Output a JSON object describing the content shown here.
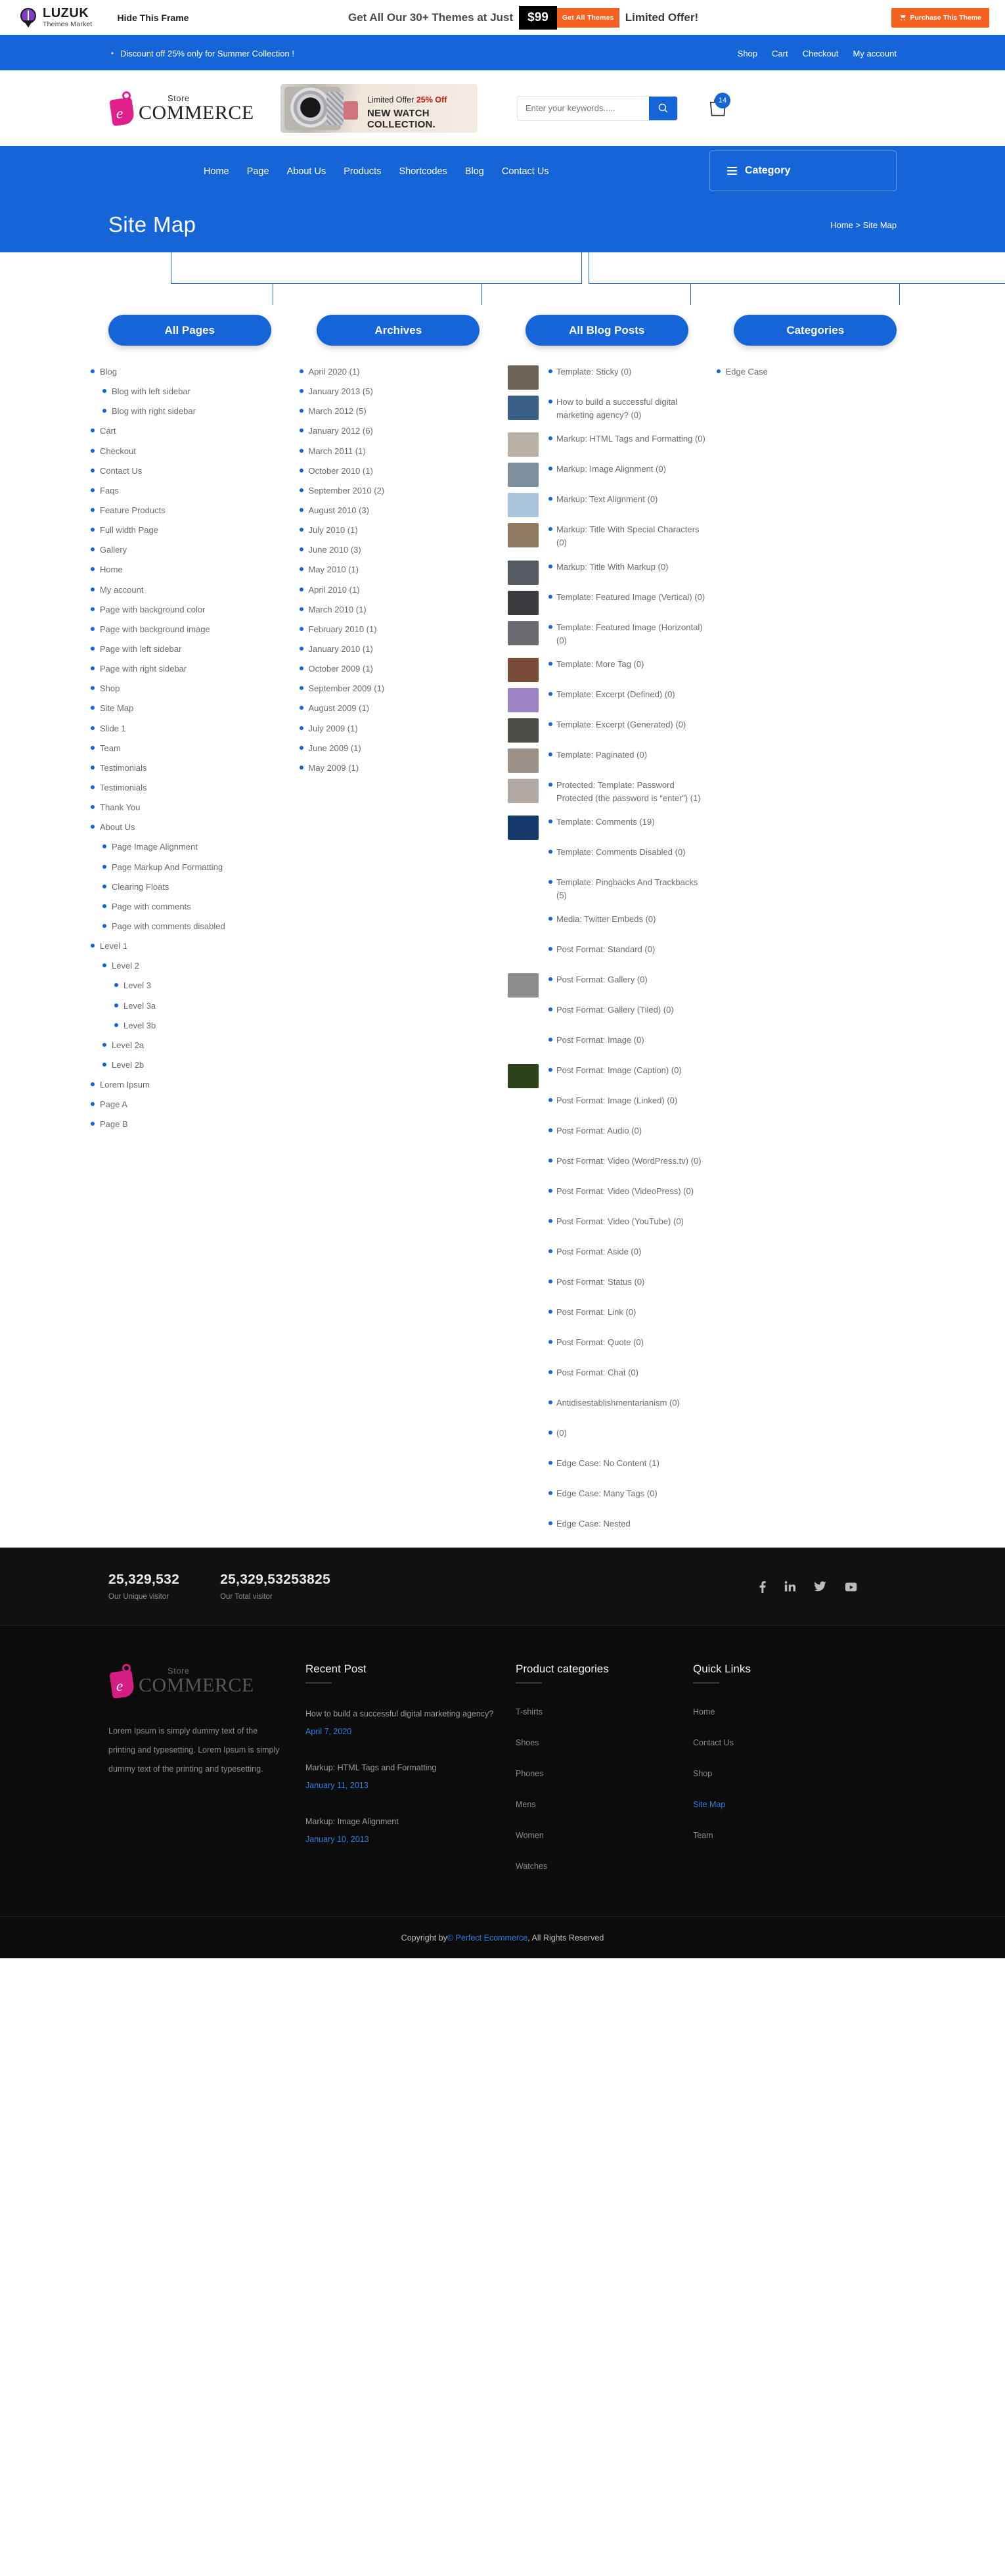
{
  "frame": {
    "brand": "LUZUK",
    "brand_sub": "Themes Market",
    "hide_label": "Hide This Frame",
    "offer_text": "Get All Our 30+ Themes at Just",
    "price": "$99",
    "get_all_label": "Get All Themes",
    "limited_label": "Limited Offer!",
    "purchase_label": "Purchase This Theme",
    "accent": "#f4601f"
  },
  "topstrip": {
    "discount_text": "Discount off 25% only for Summer Collection !",
    "links": [
      "Shop",
      "Cart",
      "Checkout",
      "My account"
    ]
  },
  "header": {
    "logo_store": "Store",
    "logo_commerce": "COMMERCE",
    "promo_line1_pre": "Limited Offer ",
    "promo_line1_strong": "25% Off",
    "promo_line2": "NEW WATCH COLLECTION.",
    "search_placeholder": "Enter your keywords.....",
    "search_value": "",
    "cart_count": "14"
  },
  "nav": {
    "items": [
      "Home",
      "Page",
      "About Us",
      "Products",
      "Shortcodes",
      "Blog",
      "Contact Us"
    ],
    "category_label": "Category"
  },
  "page": {
    "title": "Site Map",
    "breadcrumb": "Home > Site Map"
  },
  "sitemap": {
    "columns": [
      {
        "title": "All Pages"
      },
      {
        "title": "Archives"
      },
      {
        "title": "All Blog Posts"
      },
      {
        "title": "Categories"
      }
    ],
    "all_pages": [
      {
        "label": "Blog",
        "level": 1
      },
      {
        "label": "Blog with left sidebar",
        "level": 2
      },
      {
        "label": "Blog with right sidebar",
        "level": 2
      },
      {
        "label": "Cart",
        "level": 1
      },
      {
        "label": "Checkout",
        "level": 1
      },
      {
        "label": "Contact Us",
        "level": 1
      },
      {
        "label": "Faqs",
        "level": 1
      },
      {
        "label": "Feature Products",
        "level": 1
      },
      {
        "label": "Full width Page",
        "level": 1
      },
      {
        "label": "Gallery",
        "level": 1
      },
      {
        "label": "Home",
        "level": 1
      },
      {
        "label": "My account",
        "level": 1
      },
      {
        "label": "Page with background color",
        "level": 1
      },
      {
        "label": "Page with background image",
        "level": 1
      },
      {
        "label": "Page with left sidebar",
        "level": 1
      },
      {
        "label": "Page with right sidebar",
        "level": 1
      },
      {
        "label": "Shop",
        "level": 1
      },
      {
        "label": "Site Map",
        "level": 1
      },
      {
        "label": "Slide 1",
        "level": 1
      },
      {
        "label": "Team",
        "level": 1
      },
      {
        "label": "Testimonials",
        "level": 1
      },
      {
        "label": "Testimonials",
        "level": 1
      },
      {
        "label": "Thank You",
        "level": 1
      },
      {
        "label": "About Us",
        "level": 1
      },
      {
        "label": "Page Image Alignment",
        "level": 2
      },
      {
        "label": "Page Markup And Formatting",
        "level": 2
      },
      {
        "label": "Clearing Floats",
        "level": 2
      },
      {
        "label": "Page with comments",
        "level": 2
      },
      {
        "label": "Page with comments disabled",
        "level": 2
      },
      {
        "label": "Level 1",
        "level": 1
      },
      {
        "label": "Level 2",
        "level": 2
      },
      {
        "label": "Level 3",
        "level": 3
      },
      {
        "label": "Level 3a",
        "level": 3
      },
      {
        "label": "Level 3b",
        "level": 3
      },
      {
        "label": "Level 2a",
        "level": 2
      },
      {
        "label": "Level 2b",
        "level": 2
      },
      {
        "label": "Lorem Ipsum",
        "level": 1
      },
      {
        "label": "Page A",
        "level": 1
      },
      {
        "label": "Page B",
        "level": 1
      }
    ],
    "archives": [
      "April 2020 (1)",
      "January 2013 (5)",
      "March 2012 (5)",
      "January 2012 (6)",
      "March 2011 (1)",
      "October 2010 (1)",
      "September 2010 (2)",
      "August 2010 (3)",
      "July 2010 (1)",
      "June 2010 (3)",
      "May 2010 (1)",
      "April 2010 (1)",
      "March 2010 (1)",
      "February 2010 (1)",
      "January 2010 (1)",
      "October 2009 (1)",
      "September 2009 (1)",
      "August 2009 (1)",
      "July 2009 (1)",
      "June 2009 (1)",
      "May 2009 (1)"
    ],
    "blog_posts": [
      {
        "label": "Template: Sticky (0)",
        "thumb": "#6c6257"
      },
      {
        "label": "How to build a successful digital marketing agency? (0)",
        "thumb": "#3a5f86"
      },
      {
        "label": "Markup: HTML Tags and Formatting (0)",
        "thumb": "#b9b0a5"
      },
      {
        "label": "Markup: Image Alignment (0)",
        "thumb": "#7d8e9c"
      },
      {
        "label": "Markup: Text Alignment (0)",
        "thumb": "#a9c4d8"
      },
      {
        "label": "Markup: Title With Special Characters (0)",
        "thumb": "#8e7a5e"
      },
      {
        "label": "Markup: Title With Markup (0)",
        "thumb": "#555a60"
      },
      {
        "label": "Template: Featured Image (Vertical) (0)",
        "thumb": "#3c3c40"
      },
      {
        "label": "Template: Featured Image (Horizontal) (0)",
        "thumb": "#6a6a70"
      },
      {
        "label": "Template: More Tag (0)",
        "thumb": "#7a4a38"
      },
      {
        "label": "Template: Excerpt (Defined) (0)",
        "thumb": "#9b83c4"
      },
      {
        "label": "Template: Excerpt (Generated) (0)",
        "thumb": "#4b4f48"
      },
      {
        "label": "Template: Paginated (0)",
        "thumb": "#9c9188"
      },
      {
        "label": "Protected: Template: Password Protected (the password is “enter”) (1)",
        "thumb": "#b0a8a2"
      },
      {
        "label": "Template: Comments (19)",
        "thumb": "#143b6b"
      },
      {
        "label": "Template: Comments Disabled (0)",
        "thumb": ""
      },
      {
        "label": "Template: Pingbacks And Trackbacks (5)",
        "thumb": ""
      },
      {
        "label": "Media: Twitter Embeds (0)",
        "thumb": ""
      },
      {
        "label": "Post Format: Standard (0)",
        "thumb": ""
      },
      {
        "label": "Post Format: Gallery (0)",
        "thumb": "#8d8d8d"
      },
      {
        "label": "Post Format: Gallery (Tiled) (0)",
        "thumb": ""
      },
      {
        "label": "Post Format: Image (0)",
        "thumb": ""
      },
      {
        "label": "Post Format: Image (Caption) (0)",
        "thumb": "#2c4218"
      },
      {
        "label": "Post Format: Image (Linked) (0)",
        "thumb": ""
      },
      {
        "label": "Post Format: Audio (0)",
        "thumb": ""
      },
      {
        "label": "Post Format: Video (WordPress.tv) (0)",
        "thumb": ""
      },
      {
        "label": "Post Format: Video (VideoPress) (0)",
        "thumb": ""
      },
      {
        "label": "Post Format: Video (YouTube) (0)",
        "thumb": ""
      },
      {
        "label": "Post Format: Aside (0)",
        "thumb": ""
      },
      {
        "label": "Post Format: Status (0)",
        "thumb": ""
      },
      {
        "label": "Post Format: Link (0)",
        "thumb": ""
      },
      {
        "label": "Post Format: Quote (0)",
        "thumb": ""
      },
      {
        "label": "Post Format: Chat (0)",
        "thumb": ""
      },
      {
        "label": "Antidisestablishmentarianism (0)",
        "thumb": ""
      },
      {
        "label": "(0)",
        "thumb": ""
      },
      {
        "label": "Edge Case: No Content (1)",
        "thumb": ""
      },
      {
        "label": "Edge Case: Many Tags (0)",
        "thumb": ""
      },
      {
        "label": "Edge Case: Nested",
        "thumb": ""
      }
    ],
    "categories": [
      "Edge Case"
    ]
  },
  "counters": [
    {
      "number": "25,329,532",
      "label": "Our Unique visitor"
    },
    {
      "number": "25,329,53253825",
      "label": "Our Total visitor"
    }
  ],
  "socials": [
    "facebook-icon",
    "linkedin-icon",
    "twitter-icon",
    "youtube-icon"
  ],
  "footer": {
    "logo_store": "Store",
    "logo_commerce": "COMMERCE",
    "description": "Lorem Ipsum is simply dummy text of the printing and typesetting. Lorem Ipsum is simply dummy text of the printing and typesetting.",
    "recent_post_heading": "Recent Post",
    "recent_posts": [
      {
        "title": "How to build a successful digital marketing agency?",
        "date": "April 7, 2020"
      },
      {
        "title": "Markup: HTML Tags and Formatting",
        "date": "January 11, 2013"
      },
      {
        "title": "Markup: Image Alignment",
        "date": "January 10, 2013"
      }
    ],
    "categories_heading": "Product categories",
    "categories": [
      "T-shirts",
      "Shoes",
      "Phones",
      "Mens",
      "Women",
      "Watches"
    ],
    "quick_links_heading": "Quick Links",
    "quick_links": [
      {
        "label": "Home",
        "active": false
      },
      {
        "label": "Contact Us",
        "active": false
      },
      {
        "label": "Shop",
        "active": false
      },
      {
        "label": "Site Map",
        "active": true
      },
      {
        "label": "Team",
        "active": false
      }
    ]
  },
  "copyright": {
    "prefix": "Copyright by ",
    "link": "© Perfect Ecommerce",
    "suffix": ", All Rights Reserved"
  }
}
